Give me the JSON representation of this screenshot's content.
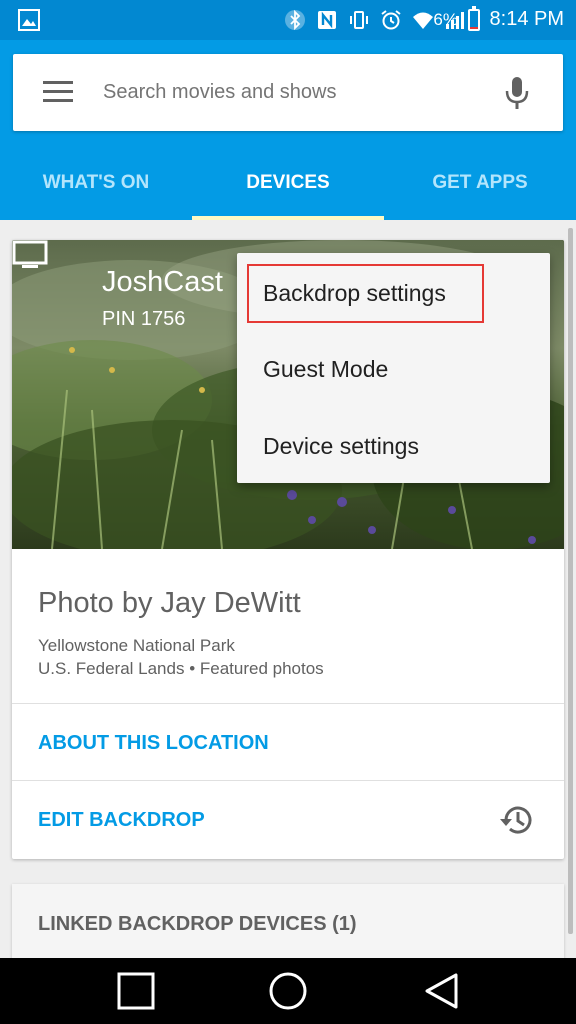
{
  "status_bar": {
    "battery_percent": "6%",
    "battery_level": 0.06,
    "time": "8:14 PM"
  },
  "search": {
    "placeholder": "Search movies and shows"
  },
  "tabs": [
    {
      "label": "WHAT'S ON",
      "active": false
    },
    {
      "label": "DEVICES",
      "active": true
    },
    {
      "label": "GET APPS",
      "active": false
    }
  ],
  "device": {
    "name": "JoshCast",
    "pin": "PIN 1756"
  },
  "photo": {
    "title": "Photo by Jay DeWitt",
    "location": "Yellowstone National Park",
    "source": "U.S. Federal Lands • Featured photos"
  },
  "actions": {
    "about_location": "ABOUT THIS LOCATION",
    "edit_backdrop": "EDIT BACKDROP"
  },
  "linked": {
    "label": "LINKED BACKDROP DEVICES (1)"
  },
  "popup_menu": {
    "items": [
      "Backdrop settings",
      "Guest Mode",
      "Device settings"
    ]
  },
  "colors": {
    "primary": "#039be5",
    "status_bar": "#0288d1",
    "highlight": "#e53935"
  }
}
